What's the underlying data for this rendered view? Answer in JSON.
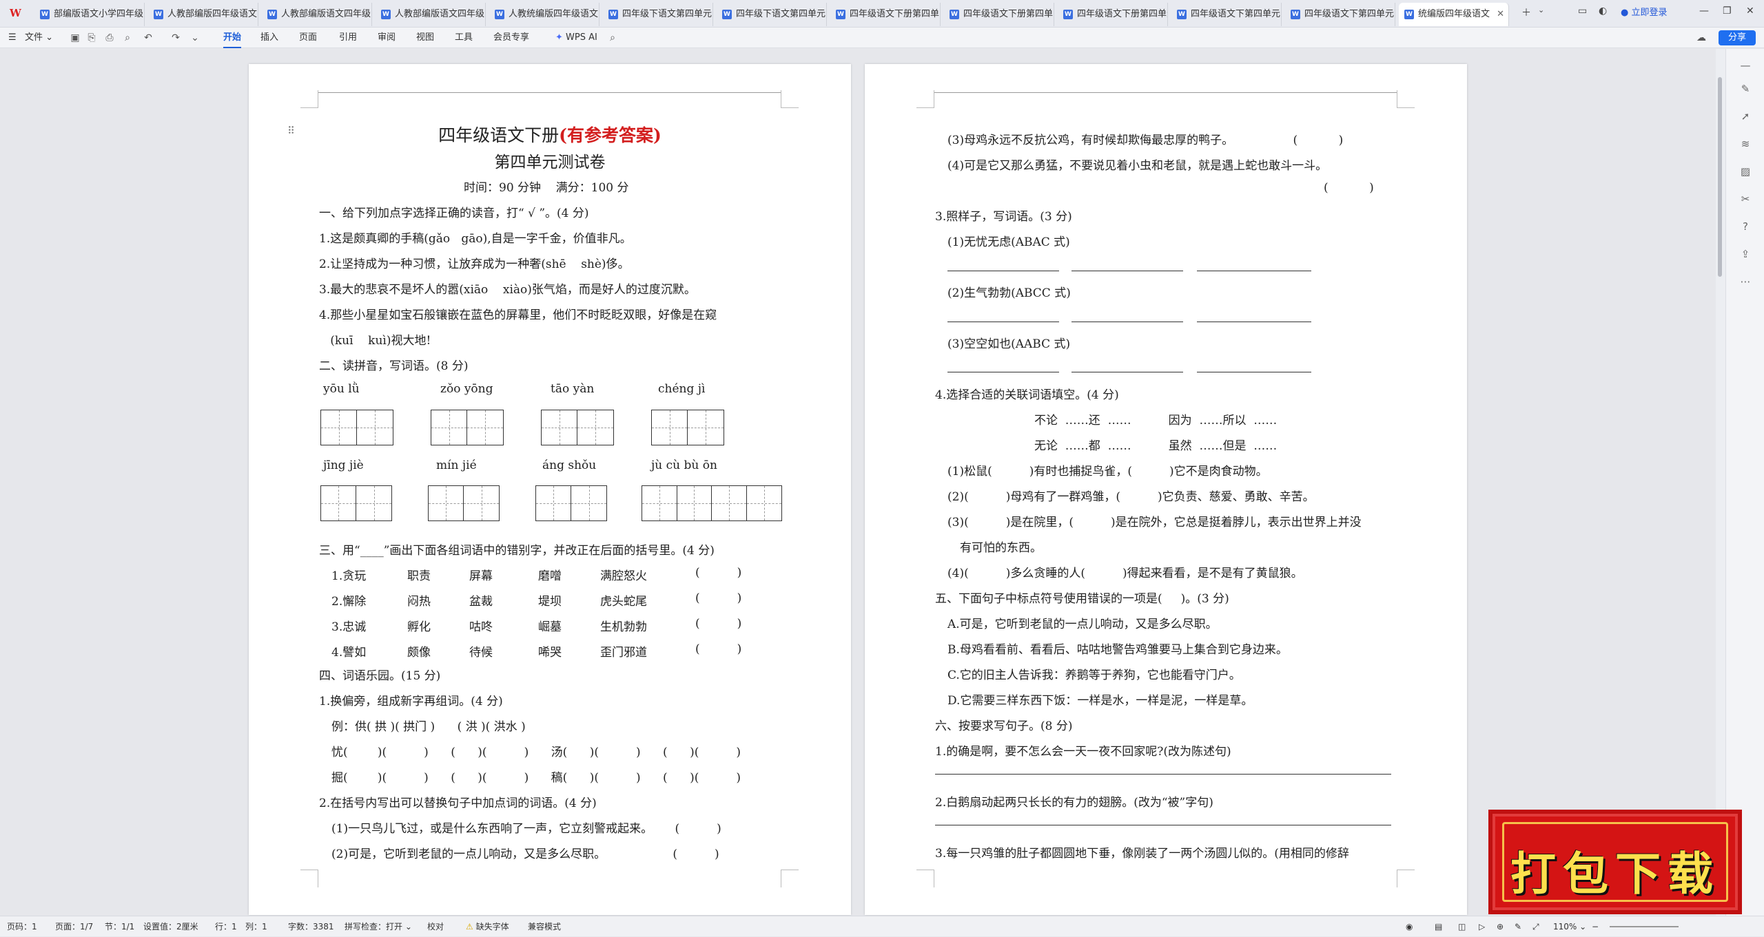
{
  "tabs": [
    {
      "label": "部编版语文小学四年级"
    },
    {
      "label": "人教部编版四年级语文"
    },
    {
      "label": "人教部编版语文四年级"
    },
    {
      "label": "人教部编版语文四年级"
    },
    {
      "label": "人教统编版四年级语文"
    },
    {
      "label": "四年级下语文第四单元"
    },
    {
      "label": "四年级下语文第四单元"
    },
    {
      "label": "四年级语文下册第四单"
    },
    {
      "label": "四年级语文下册第四单"
    },
    {
      "label": "四年级语文下册第四单元"
    },
    {
      "label": "四年级语文下第四单元"
    },
    {
      "label": "四年级语文下第四单元"
    },
    {
      "label": "统编版四年级语文"
    }
  ],
  "login": "立即登录",
  "ribbon": {
    "file": "文件",
    "items": [
      "开始",
      "插入",
      "页面",
      "引用",
      "审阅",
      "视图",
      "工具",
      "会员专享"
    ],
    "wps_ai": "WPS AI",
    "share": "分享"
  },
  "page1": {
    "title_main": "四年级语文下册",
    "title_red": "(有参考答案)",
    "title2": "第四单元测试卷",
    "time": "时间：90 分钟    满分：100 分",
    "lines": [
      "一、给下列加点字选择正确的读音，打“ √ ”。(4 分)",
      "1.这是颇真卿的手稿(gǎo   gāo),自是一字千金，价值非凡。",
      "2.让坚持成为一种习惯，让放弃成为一种奢(shē    shè)侈。",
      "3.最大的悲哀不是坏人的嚣(xiāo    xiào)张气焰，而是好人的过度沉默。",
      "4.那些小星星如宝石般镶嵌在蓝色的屏幕里，他们不时眨眨双眼，好像是在窥",
      "   (kuī    kuì)视大地!",
      "二、读拼音，写词语。(8 分)"
    ],
    "pinyin1": [
      "yōu    lǜ",
      "zǒo    yōng",
      "tāo    yàn",
      "chéng    jì"
    ],
    "pinyin2": [
      "jīng    jiè",
      "mín    jié",
      "áng    shǒu",
      "jù    cù    bù    ōn"
    ],
    "sec3": "三、用“____”画出下面各组词语中的错别字，并改正在后面的括号里。(4 分)",
    "sec3_rows": [
      [
        "1.贪玩",
        "职责",
        "屏幕",
        "磨噌",
        "满腔怒火",
        "(          )"
      ],
      [
        "2.懈除",
        "闷热",
        "盆裁",
        "堤坝",
        "虎头蛇尾",
        "(          )"
      ],
      [
        "3.忠诚",
        "孵化",
        "咕咚",
        "崛墓",
        "生机勃勃",
        "(          )"
      ],
      [
        "4.譬如",
        "颇像",
        "待候",
        "唏哭",
        "歪门邪道",
        "(          )"
      ]
    ],
    "sec4": "四、词语乐园。(15 分)",
    "sec4_1": "1.换偏旁，组成新字再组词。(4 分)",
    "example": "例：供( 拱 )( 拱门 )      ( 洪 )( 洪水 )",
    "row_a": "忧(        )(          )      (      )(          )      汤(      )(          )      (      )(          )",
    "row_b": "掘(        )(          )      (      )(          )      稿(      )(          )      (      )(          )",
    "sec4_2": "2.在括号内写出可以替换句子中加点词的词语。(4 分)",
    "sec4_2a": "(1)一只鸟儿飞过，或是什么东西响了一声，它立刻警戒起来。      (          )",
    "sec4_2b": "(2)可是，它听到老鼠的一点儿响动，又是多么尽职。                  (          )"
  },
  "page2": {
    "l1": "(3)母鸡永远不反抗公鸡，有时候却欺侮最忠厚的鸭子。                (           )",
    "l2": "(4)可是它又那么勇猛，不要说见着小虫和老鼠，就是遇上蛇也敢斗一斗。",
    "l2b": "(           )",
    "sec3": "3.照样子，写词语。(3 分)",
    "s3a": "(1)无忧无虑(ABAC 式)",
    "s3b": "(2)生气勃勃(ABCC 式)",
    "s3c": "(3)空空如也(AABC 式)",
    "sec4": "4.选择合适的关联词语填空。(4 分)",
    "conj1": "不论  ……还  ……          因为  ……所以  ……",
    "conj2": "无论  ……都  ……          虽然  ……但是  ……",
    "q1": "(1)松鼠(          )有时也捕捉鸟雀，(          )它不是肉食动物。",
    "q2": "(2)(          )母鸡有了一群鸡雏，(          )它负责、慈爱、勇敢、辛苦。",
    "q3": "(3)(          )是在院里，(          )是在院外，它总是挺着脖儿，表示出世界上并没",
    "q3b": "有可怕的东西。",
    "q4": "(4)(          )多么贪睡的人(          )得起来看看，是不是有了黄鼠狼。",
    "sec5": "五、下面句子中标点符号使用错误的一项是(     )。(3 分)",
    "optA": "A.可是，它听到老鼠的一点儿响动，又是多么尽职。",
    "optB": "B.母鸡看看前、看看后、咕咕地警告鸡雏要马上集合到它身边来。",
    "optC": "C.它的旧主人告诉我：养鹅等于养狗，它也能看守门户。",
    "optD": "D.它需要三样东西下饭：一样是水，一样是泥，一样是草。",
    "sec6": "六、按要求写句子。(8 分)",
    "s6a": "1.的确是啊，要不怎么会一天一夜不回家呢?(改为陈述句)",
    "s6b": "2.白鹅扇动起两只长长的有力的翅膀。(改为“被”字句)",
    "s6c": "3.每一只鸡雏的肚子都圆圆地下垂，像刚装了一两个汤圆儿似的。(用相同的修辞"
  },
  "status": {
    "page": "页码：1",
    "pages": "页面：1/7",
    "section": "节：1/1",
    "setting": "设置值：2厘米",
    "row": "行：1",
    "col": "列：1",
    "words": "字数：3381",
    "spell": "拼写检查：打开",
    "proof": "校对",
    "missing_font": "缺失字体",
    "compat": "兼容模式",
    "zoom": "110%"
  },
  "banner": "打包下载"
}
